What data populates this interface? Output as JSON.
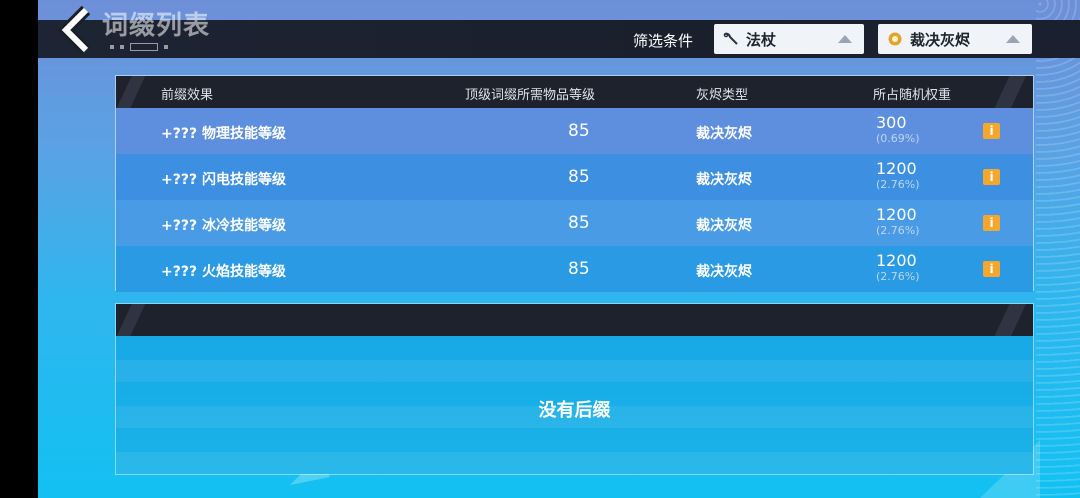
{
  "header": {
    "title": "词缀列表",
    "filter_label": "筛选条件",
    "weapon_filter": {
      "value": "法杖",
      "icon": "wand-icon"
    },
    "ember_filter": {
      "value": "裁决灰烬",
      "icon": "ember-icon"
    }
  },
  "prefix_table": {
    "columns": [
      "前缀效果",
      "顶级词缀所需物品等级",
      "灰烬类型",
      "所占随机权重"
    ],
    "rows": [
      {
        "effect": "+??? 物理技能等级",
        "level": "85",
        "ember": "裁决灰烬",
        "weight": "300",
        "percent": "(0.69%)"
      },
      {
        "effect": "+??? 闪电技能等级",
        "level": "85",
        "ember": "裁决灰烬",
        "weight": "1200",
        "percent": "(2.76%)"
      },
      {
        "effect": "+??? 冰冷技能等级",
        "level": "85",
        "ember": "裁决灰烬",
        "weight": "1200",
        "percent": "(2.76%)"
      },
      {
        "effect": "+??? 火焰技能等级",
        "level": "85",
        "ember": "裁决灰烬",
        "weight": "1200",
        "percent": "(2.76%)"
      }
    ]
  },
  "suffix_panel": {
    "empty_text": "没有后缀"
  },
  "colors": {
    "header_bg": "#1d2433",
    "info_button": "#f3a72c",
    "row_a": "#5d8fde",
    "row_b": "#2f8fe0"
  }
}
